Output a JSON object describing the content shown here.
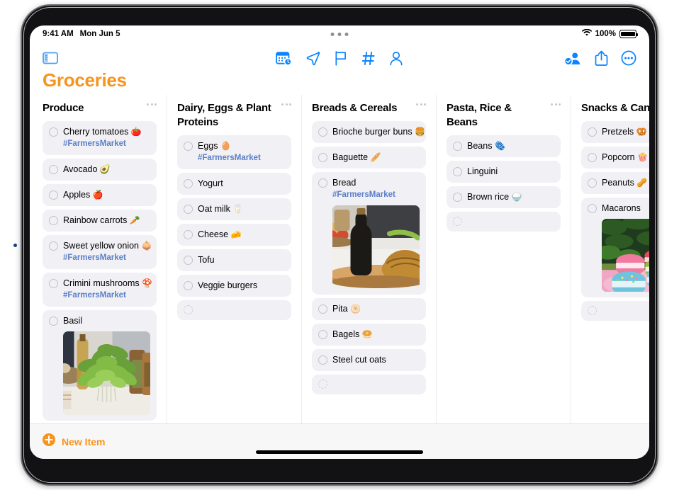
{
  "status_bar": {
    "time": "9:41 AM",
    "date": "Mon Jun 5",
    "battery_percent": "100%",
    "wifi_icon": "wifi-icon",
    "battery_icon": "battery-full-icon",
    "multitask_handle": "multitasking-dots"
  },
  "toolbar": {
    "sidebar_toggle": "sidebar-toggle-icon",
    "center_items": [
      {
        "name": "calendar-clock-icon",
        "label": "Date & Time"
      },
      {
        "name": "location-arrow-icon",
        "label": "Location"
      },
      {
        "name": "flag-icon",
        "label": "Flag"
      },
      {
        "name": "hashtag-icon",
        "label": "Tags"
      },
      {
        "name": "person-icon",
        "label": "Assign"
      }
    ],
    "right_items": [
      {
        "name": "shared-person-icon",
        "label": "Collaborate"
      },
      {
        "name": "share-icon",
        "label": "Share"
      },
      {
        "name": "more-ellipsis-icon",
        "label": "More"
      }
    ]
  },
  "page_title": "Groceries",
  "accent_color": "#f7941e",
  "tint_color": "#0a84ff",
  "tag_color": "#5b7fc7",
  "item_bg_color": "#f0f0f5",
  "columns": [
    {
      "title": "Produce",
      "menu": "section-menu-icon",
      "items": [
        {
          "text": "Cherry tomatoes",
          "emoji": "🍅",
          "tag": "#FarmersMarket"
        },
        {
          "text": "Avocado",
          "emoji": "🥑",
          "tag": ""
        },
        {
          "text": "Apples",
          "emoji": "🍎",
          "tag": ""
        },
        {
          "text": "Rainbow carrots",
          "emoji": "🥕",
          "tag": ""
        },
        {
          "text": "Sweet yellow onion",
          "emoji": "🧅",
          "tag": "#FarmersMarket"
        },
        {
          "text": "Crimini mushrooms",
          "emoji": "🍄",
          "tag": "#FarmersMarket"
        },
        {
          "text": "Basil",
          "emoji": "",
          "tag": "",
          "photo": "basil"
        },
        {
          "text": "",
          "emoji": "",
          "tag": "",
          "empty": true
        }
      ]
    },
    {
      "title": "Dairy, Eggs & Plant Proteins",
      "menu": "section-menu-icon",
      "items": [
        {
          "text": "Eggs",
          "emoji": "🥚",
          "tag": "#FarmersMarket"
        },
        {
          "text": "Yogurt",
          "emoji": "",
          "tag": ""
        },
        {
          "text": "Oat milk",
          "emoji": "🥛",
          "tag": ""
        },
        {
          "text": "Cheese",
          "emoji": "🧀",
          "tag": ""
        },
        {
          "text": "Tofu",
          "emoji": "",
          "tag": ""
        },
        {
          "text": "Veggie burgers",
          "emoji": "",
          "tag": ""
        },
        {
          "text": "",
          "emoji": "",
          "tag": "",
          "empty": true
        }
      ]
    },
    {
      "title": "Breads & Cereals",
      "menu": "section-menu-icon",
      "items": [
        {
          "text": "Brioche burger buns",
          "emoji": "🍔",
          "tag": ""
        },
        {
          "text": "Baguette",
          "emoji": "🥖",
          "tag": ""
        },
        {
          "text": "Bread",
          "emoji": "",
          "tag": "#FarmersMarket",
          "photo": "bread"
        },
        {
          "text": "Pita",
          "emoji": "🫓",
          "tag": ""
        },
        {
          "text": "Bagels",
          "emoji": "🥯",
          "tag": ""
        },
        {
          "text": "Steel cut oats",
          "emoji": "",
          "tag": ""
        },
        {
          "text": "",
          "emoji": "",
          "tag": "",
          "empty": true
        }
      ]
    },
    {
      "title": "Pasta, Rice & Beans",
      "menu": "section-menu-icon",
      "items": [
        {
          "text": "Beans",
          "emoji": "🫆",
          "tag": ""
        },
        {
          "text": "Linguini",
          "emoji": "",
          "tag": ""
        },
        {
          "text": "Brown rice",
          "emoji": "🍚",
          "tag": ""
        },
        {
          "text": "",
          "emoji": "",
          "tag": "",
          "empty": true
        }
      ]
    },
    {
      "title": "Snacks & Candy",
      "menu": "section-menu-icon",
      "items": [
        {
          "text": "Pretzels",
          "emoji": "🥨",
          "tag": ""
        },
        {
          "text": "Popcorn",
          "emoji": "🍿",
          "tag": ""
        },
        {
          "text": "Peanuts",
          "emoji": "🥜",
          "tag": ""
        },
        {
          "text": "Macarons",
          "emoji": "",
          "tag": "",
          "photo": "macaron"
        },
        {
          "text": "",
          "emoji": "",
          "tag": "",
          "empty": true
        }
      ]
    }
  ],
  "new_item": {
    "label": "New Item",
    "icon": "plus-circle-icon"
  },
  "home_indicator": "home-indicator"
}
